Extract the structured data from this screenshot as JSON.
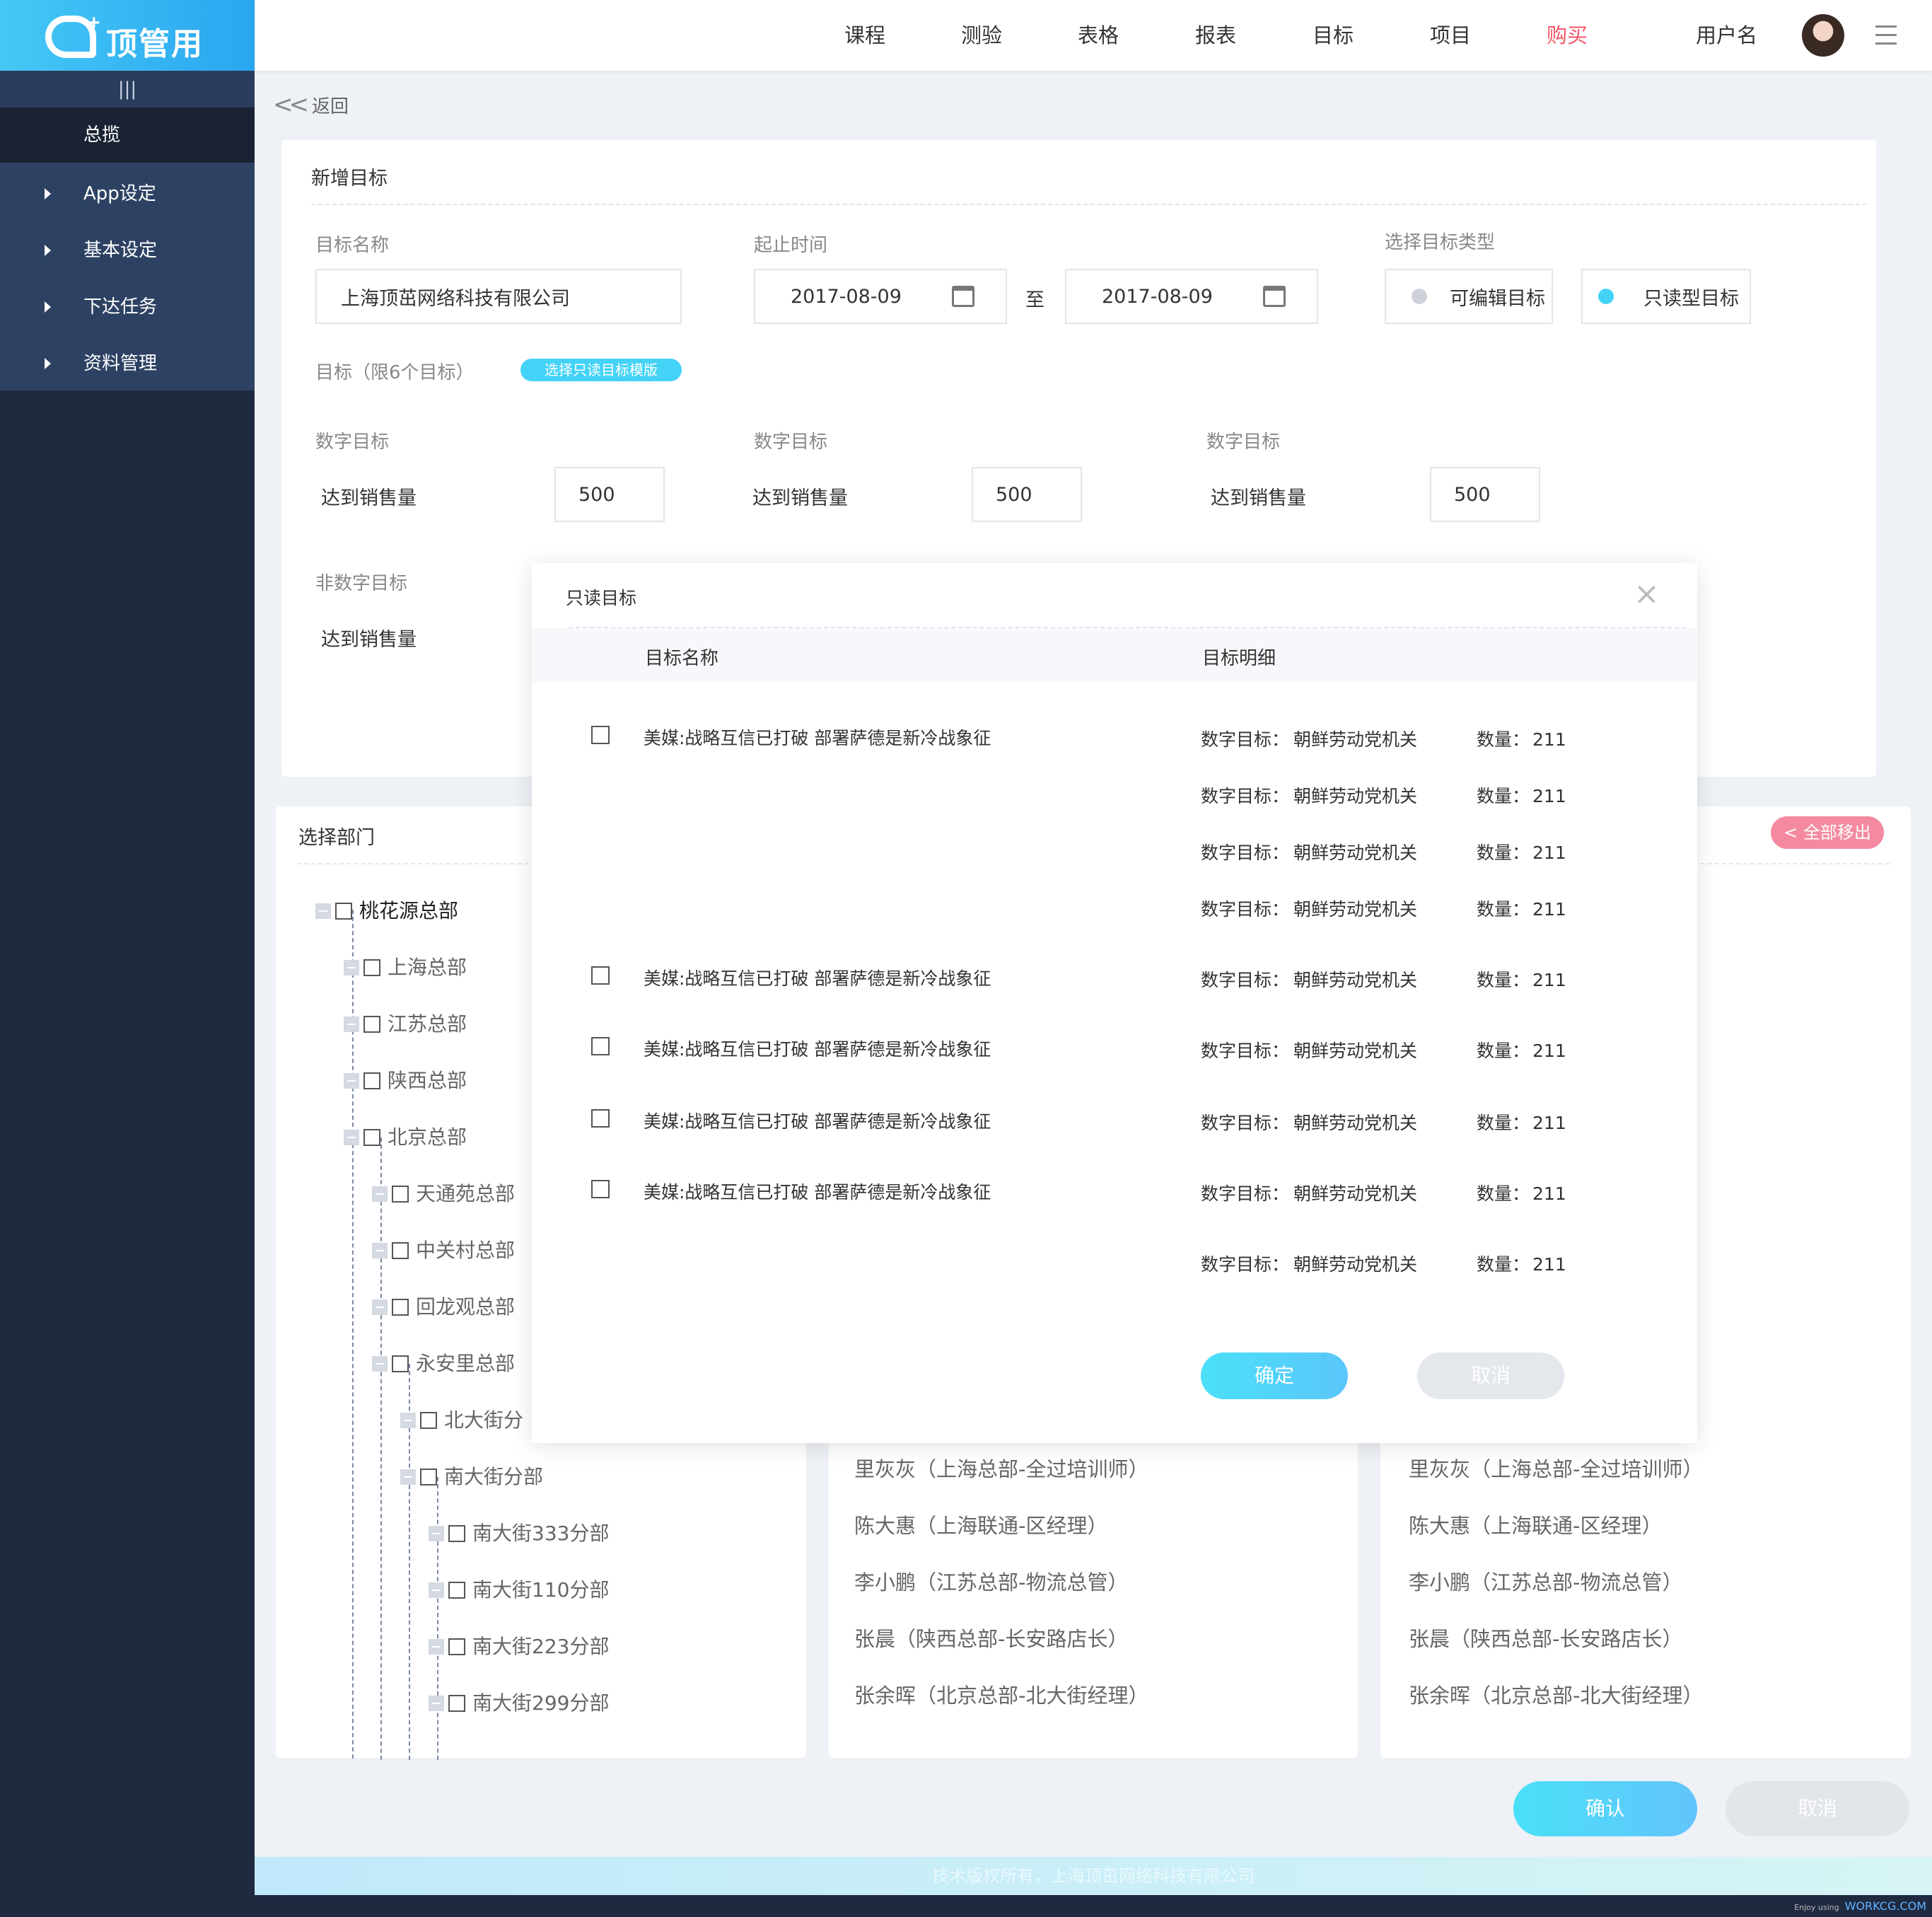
{
  "logo": {
    "plus": "+",
    "brand": "顶管用"
  },
  "sidebar": {
    "collapse_icon": "|||",
    "overview": "总揽",
    "items": [
      {
        "label": "App设定"
      },
      {
        "label": "基本设定"
      },
      {
        "label": "下达任务"
      },
      {
        "label": "资料管理"
      }
    ]
  },
  "header": {
    "nav": [
      "课程",
      "测验",
      "表格",
      "报表",
      "目标",
      "项目",
      "购买"
    ],
    "active_color": "#f25767",
    "username": "用户名"
  },
  "back": {
    "label": "返回"
  },
  "form": {
    "title": "新增目标",
    "name_label": "目标名称",
    "name_value": "上海顶茁网络科技有限公司",
    "date_label": "起止时间",
    "date_start": "2017-08-09",
    "date_sep": "至",
    "date_end": "2017-08-09",
    "type_label": "选择目标类型",
    "type_editable": "可编辑目标",
    "type_readonly": "只读型目标",
    "goal_label": "目标（限6个目标）",
    "template_btn": "选择只读目标模版",
    "numeric": [
      {
        "label": "数字目标",
        "item": "达到销售量",
        "value": "500"
      },
      {
        "label": "数字目标",
        "item": "达到销售量",
        "value": "500"
      },
      {
        "label": "数字目标",
        "item": "达到销售量",
        "value": "500"
      }
    ],
    "non_numeric_label": "非数字目标",
    "non_numeric_item": "达到销售量"
  },
  "dept": {
    "title": "选择部门",
    "remove_all": "全部移出",
    "tree": [
      "桃花源总部",
      "上海总部",
      "江苏总部",
      "陕西总部",
      "北京总部",
      "天通苑总部",
      "中关村总部",
      "回龙观总部",
      "永安里总部",
      "北大街分",
      "南大街分部",
      "南大街333分部",
      "南大街110分部",
      "南大街223分部",
      "南大街299分部"
    ],
    "employees": [
      "里灰灰（上海总部-全过培训师）",
      "陈大惠（上海联通-区经理）",
      "李小鹏（江苏总部-物流总管）",
      "张晨（陕西总部-长安路店长）",
      "张余晖（北京总部-北大街经理）"
    ]
  },
  "modal": {
    "title": "只读目标",
    "close": "×",
    "col_name": "目标名称",
    "col_detail": "目标明细",
    "item_name": "美媒:战略互信已打破 部署萨德是新冷战象征",
    "detail_label": "数字目标：",
    "detail_value": "朝鲜劳动党机关",
    "qty_label": "数量：",
    "qty_value": "211",
    "confirm": "确定",
    "cancel": "取消"
  },
  "actions": {
    "confirm": "确认",
    "cancel": "取消"
  },
  "footer": {
    "copyright": "技术版权所有，上海顶茁网络科技有限公司"
  },
  "watermark": {
    "small": "Enjoy using",
    "site": "WORKCG.COM"
  },
  "colors": {
    "accent": "#4ad6f8",
    "danger": "#f25767",
    "sidebar": "#1f2940"
  }
}
